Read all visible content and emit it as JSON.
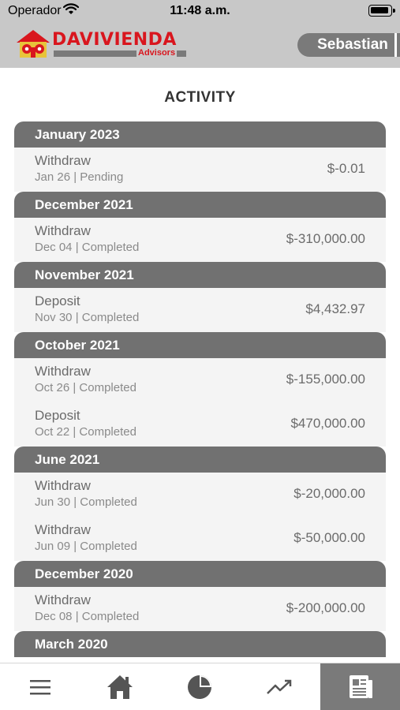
{
  "status_bar": {
    "carrier": "Operador",
    "time": "11:48 a.m."
  },
  "header": {
    "logo_word": "DAVIVIENDA",
    "logo_sub": "Advisors",
    "user_name": "Sebastian"
  },
  "page_title": "ACTIVITY",
  "groups": [
    {
      "month": "January 2023",
      "items": [
        {
          "type": "Withdraw",
          "meta": "Jan 26 | Pending",
          "amount": "$-0.01"
        }
      ]
    },
    {
      "month": "December 2021",
      "items": [
        {
          "type": "Withdraw",
          "meta": "Dec 04 | Completed",
          "amount": "$-310,000.00"
        }
      ]
    },
    {
      "month": "November 2021",
      "items": [
        {
          "type": "Deposit",
          "meta": "Nov 30 | Completed",
          "amount": "$4,432.97"
        }
      ]
    },
    {
      "month": "October 2021",
      "items": [
        {
          "type": "Withdraw",
          "meta": "Oct 26 | Completed",
          "amount": "$-155,000.00"
        },
        {
          "type": "Deposit",
          "meta": "Oct 22 | Completed",
          "amount": "$470,000.00"
        }
      ]
    },
    {
      "month": "June 2021",
      "items": [
        {
          "type": "Withdraw",
          "meta": "Jun 30 | Completed",
          "amount": "$-20,000.00"
        },
        {
          "type": "Withdraw",
          "meta": "Jun 09 | Completed",
          "amount": "$-50,000.00"
        }
      ]
    },
    {
      "month": "December 2020",
      "items": [
        {
          "type": "Withdraw",
          "meta": "Dec 08 | Completed",
          "amount": "$-200,000.00"
        }
      ]
    },
    {
      "month": "March 2020",
      "items": []
    }
  ],
  "tab_bar": {
    "tabs": [
      {
        "icon": "menu-icon"
      },
      {
        "icon": "home-icon"
      },
      {
        "icon": "pie-chart-icon"
      },
      {
        "icon": "trending-up-icon"
      },
      {
        "icon": "statement-icon",
        "active": true
      }
    ]
  },
  "colors": {
    "brand_red": "#d9161e",
    "header_gray": "#c8c8c8",
    "group_gray": "#717171"
  }
}
